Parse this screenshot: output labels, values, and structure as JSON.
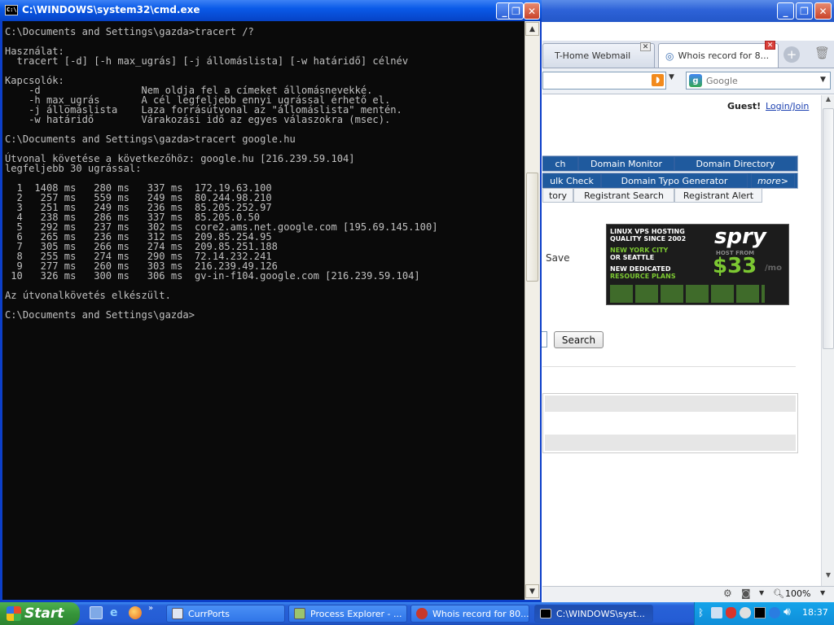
{
  "browser": {
    "tabs": [
      {
        "label": "T-Home Webmail"
      },
      {
        "label": "Whois record for 8..."
      }
    ],
    "search_placeholder": "Google",
    "guest_label": "Guest!",
    "login_link": "Login/Join",
    "nav_row1": [
      "ch",
      "Domain Monitor",
      "Domain Directory"
    ],
    "nav_row2": [
      "ulk Check",
      "Domain Typo Generator",
      "more>"
    ],
    "nav_row3": [
      "tory",
      "Registrant Search",
      "Registrant Alert"
    ],
    "save_label": "Save",
    "search_button": "Search",
    "zoom": "100%",
    "ad": {
      "line1": "LINUX VPS HOSTING",
      "line2": "QUALITY SINCE 2002",
      "line3": "NEW YORK CITY",
      "line4": "OR SEATTLE",
      "line5": "NEW DEDICATED",
      "line6": "RESOURCE PLANS",
      "brand": "spry",
      "host_from": "HOST FROM",
      "price": "$33",
      "per": "/mo"
    }
  },
  "cmd": {
    "title": "C:\\WINDOWS\\system32\\cmd.exe",
    "output": "C:\\Documents and Settings\\gazda>tracert /?\n\nHasználat:\n  tracert [-d] [-h max_ugrás] [-j állomáslista] [-w határidő] célnév\n\nKapcsolók:\n    -d                 Nem oldja fel a címeket állomásnevekké.\n    -h max_ugrás       A cél legfeljebb ennyi ugrással érhető el.\n    -j állomáslista    Laza forrásútvonal az \"állomáslista\" mentén.\n    -w határidő        Várakozási idő az egyes válaszokra (msec).\n\nC:\\Documents and Settings\\gazda>tracert google.hu\n\nÚtvonal követése a következőhöz: google.hu [216.239.59.104]\nlegfeljebb 30 ugrással:\n\n  1  1408 ms   280 ms   337 ms  172.19.63.100\n  2   257 ms   559 ms   249 ms  80.244.98.210\n  3   251 ms   249 ms   236 ms  85.205.252.97\n  4   238 ms   286 ms   337 ms  85.205.0.50\n  5   292 ms   237 ms   302 ms  core2.ams.net.google.com [195.69.145.100]\n  6   265 ms   236 ms   312 ms  209.85.254.95\n  7   305 ms   266 ms   274 ms  209.85.251.188\n  8   255 ms   274 ms   290 ms  72.14.232.241\n  9   277 ms   260 ms   303 ms  216.239.49.126\n 10   326 ms   300 ms   306 ms  gv-in-f104.google.com [216.239.59.104]\n\nAz útvonalkövetés elkészült.\n\nC:\\Documents and Settings\\gazda>"
  },
  "taskbar": {
    "start_label": "Start",
    "tasks": [
      {
        "label": "CurrPorts"
      },
      {
        "label": "Process Explorer - ..."
      },
      {
        "label": "Whois record for 80..."
      },
      {
        "label": "C:\\WINDOWS\\syst..."
      }
    ],
    "clock": "18:37"
  },
  "colors": {
    "cmd_bg": "#0a0a0a",
    "cmd_fg": "#c0c0c0",
    "xp_blue": "#245cd4",
    "start_green": "#36953a",
    "nav_blue": "#1f5a9e"
  }
}
